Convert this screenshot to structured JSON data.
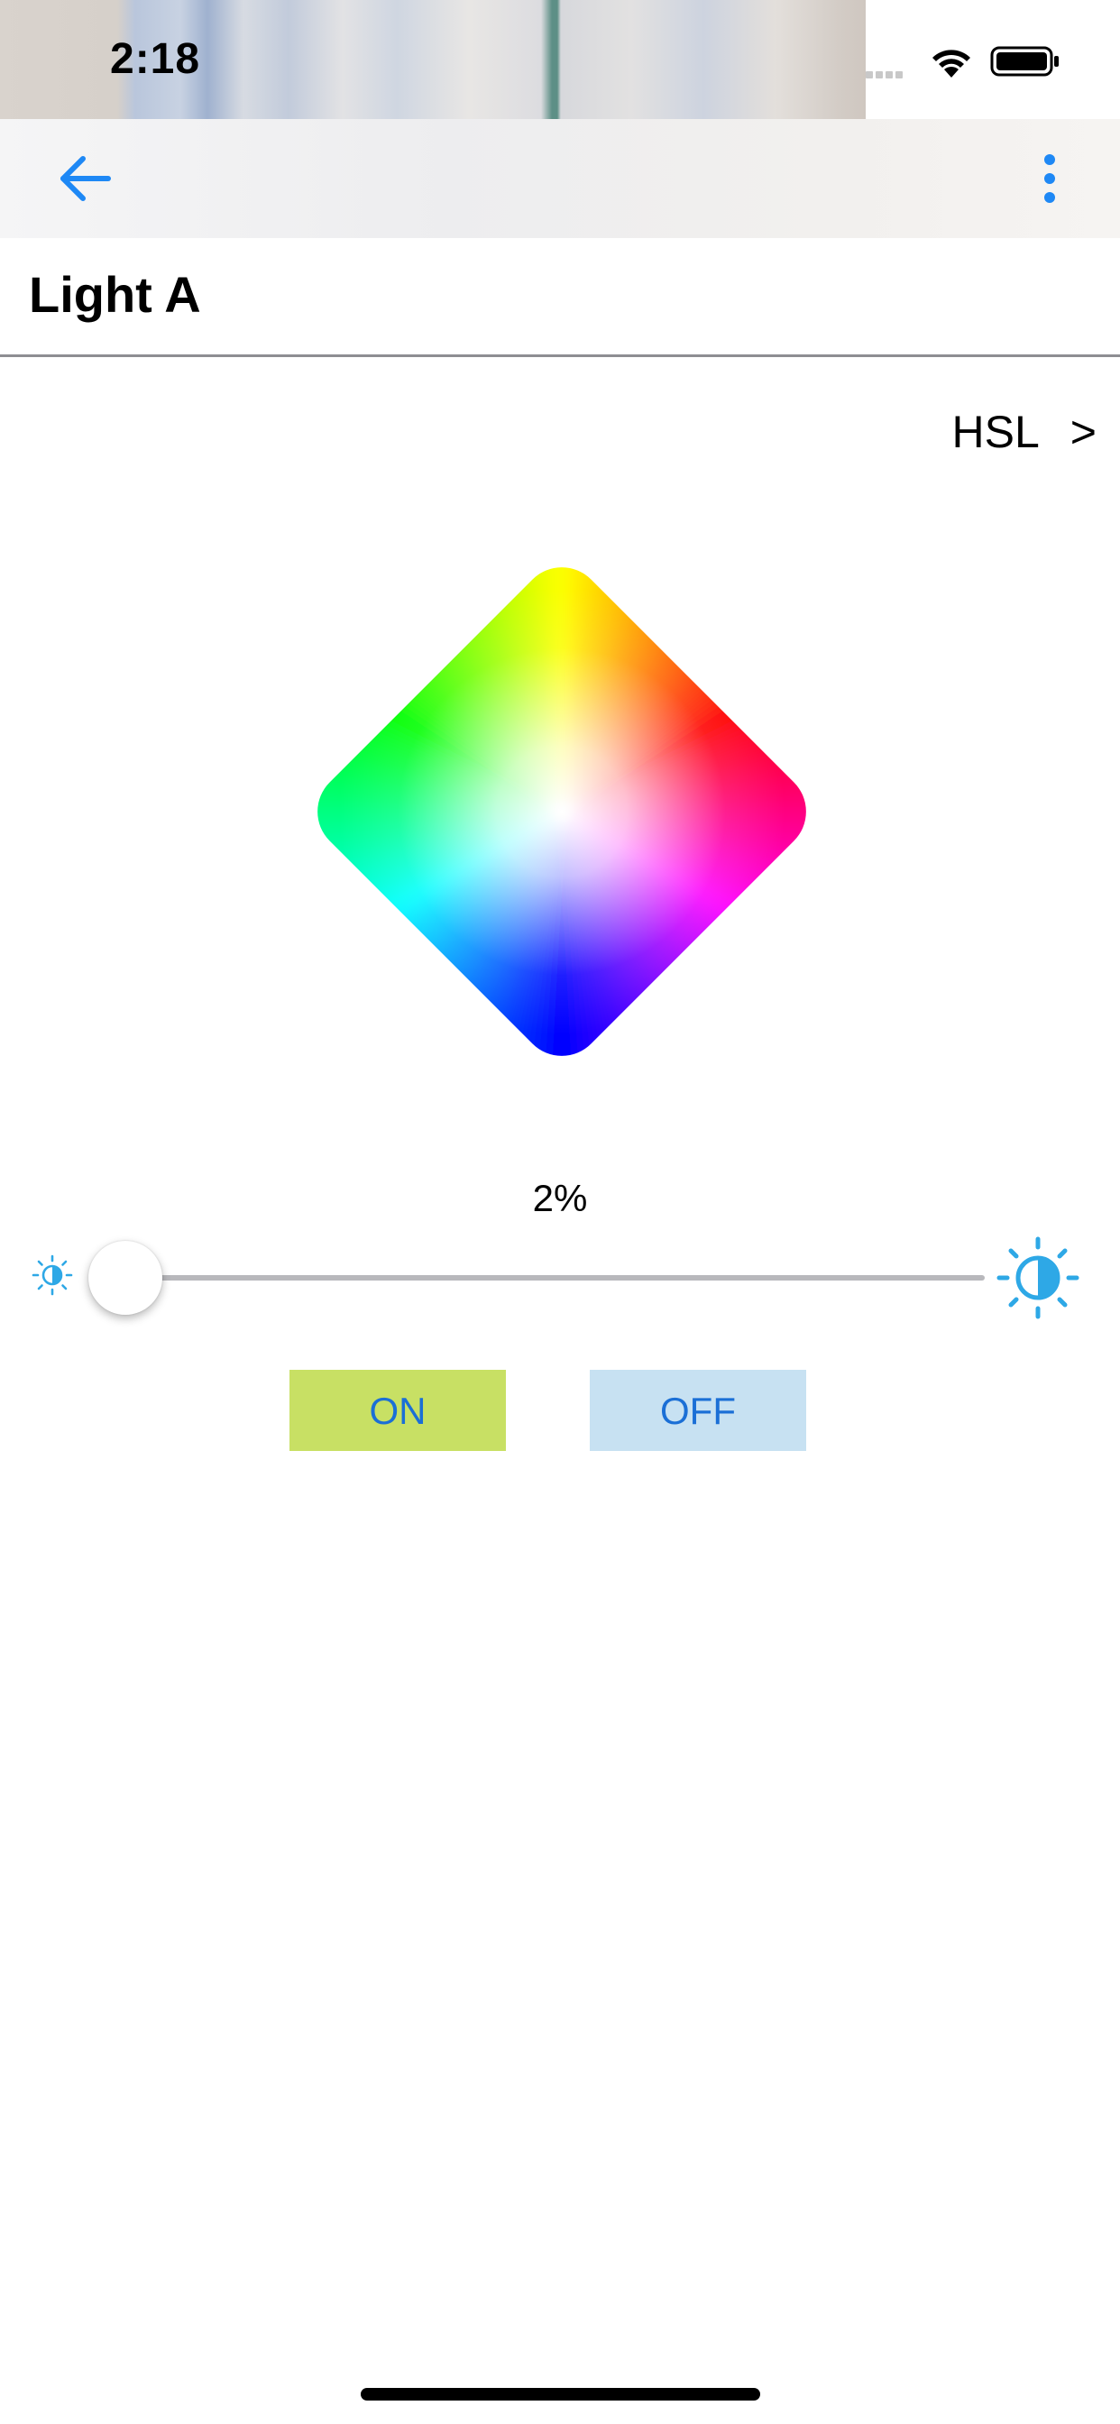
{
  "status_bar": {
    "time": "2:18"
  },
  "nav": {
    "back_icon": "arrow-left-icon",
    "more_icon": "vertical-ellipsis-icon",
    "accent_color": "#1e88f5"
  },
  "device": {
    "title": "Light A"
  },
  "color_mode": {
    "label": "HSL",
    "chevron": ">"
  },
  "color_picker": {
    "icon": "hsl-color-wheel"
  },
  "brightness": {
    "value_text": "2%",
    "value_fraction": 0.02,
    "low_icon": "brightness-low-icon",
    "high_icon": "brightness-high-icon",
    "icon_color": "#2ea8e6"
  },
  "power": {
    "on_label": "ON",
    "off_label": "OFF",
    "on_color": "#c8e064",
    "off_color": "#c7e1f2",
    "text_color": "#1b6fd6"
  }
}
